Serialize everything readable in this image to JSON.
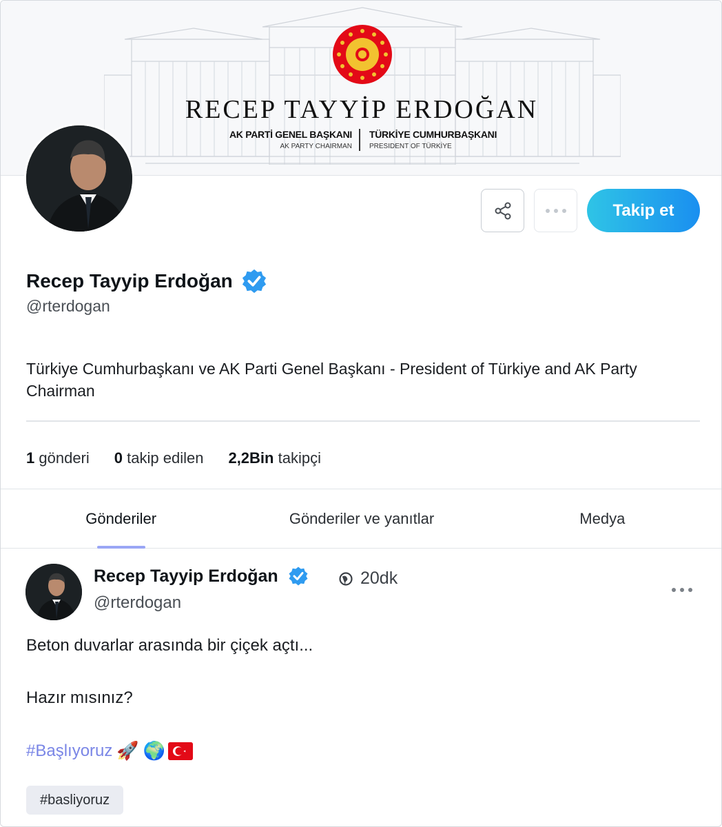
{
  "banner": {
    "title": "RECEP TAYYİP ERDOĞAN",
    "left_title": "AK PARTİ GENEL BAŞKANI",
    "left_subtitle": "AK PARTY CHAIRMAN",
    "right_title": "TÜRKİYE CUMHURBAŞKANI",
    "right_subtitle": "PRESIDENT OF TÜRKİYE",
    "seal_color": "#e30a17"
  },
  "profile": {
    "display_name": "Recep Tayyip Erdoğan",
    "handle": "@rterdogan",
    "bio": "Türkiye Cumhurbaşkanı ve AK Parti Genel Başkanı - President of Türkiye and AK Party Chairman",
    "verified_icon": "verified-badge-icon",
    "verified_color": "#2f9bf0"
  },
  "actions": {
    "share_icon": "share-icon",
    "more_icon": "more-icon",
    "follow_label": "Takip et"
  },
  "stats": {
    "posts_count": "1",
    "posts_label": "gönderi",
    "following_count": "0",
    "following_label": "takip edilen",
    "followers_count": "2,2Bin",
    "followers_label": "takipçi"
  },
  "tabs": [
    {
      "label": "Gönderiler",
      "active": true
    },
    {
      "label": "Gönderiler ve yanıtlar",
      "active": false
    },
    {
      "label": "Medya",
      "active": false
    }
  ],
  "post": {
    "author_name": "Recep Tayyip Erdoğan",
    "author_handle": "@rterdogan",
    "time": "20dk",
    "visibility_icon": "globe-icon",
    "more_icon": "more-icon",
    "line1": "Beton duvarlar arasında bir çiçek açtı...",
    "line2": "Hazır mısınız?",
    "hashtag": "#Başlıyoruz",
    "emojis": [
      "rocket-emoji",
      "globe-emoji",
      "turkey-flag-emoji"
    ],
    "rocket": "🚀",
    "earth": "🌍",
    "tag_chip": "#basliyoruz"
  },
  "colors": {
    "accent": "#1a8ff0",
    "hashtag": "#7a86e6",
    "tab_indicator": "#9aa6f5"
  }
}
